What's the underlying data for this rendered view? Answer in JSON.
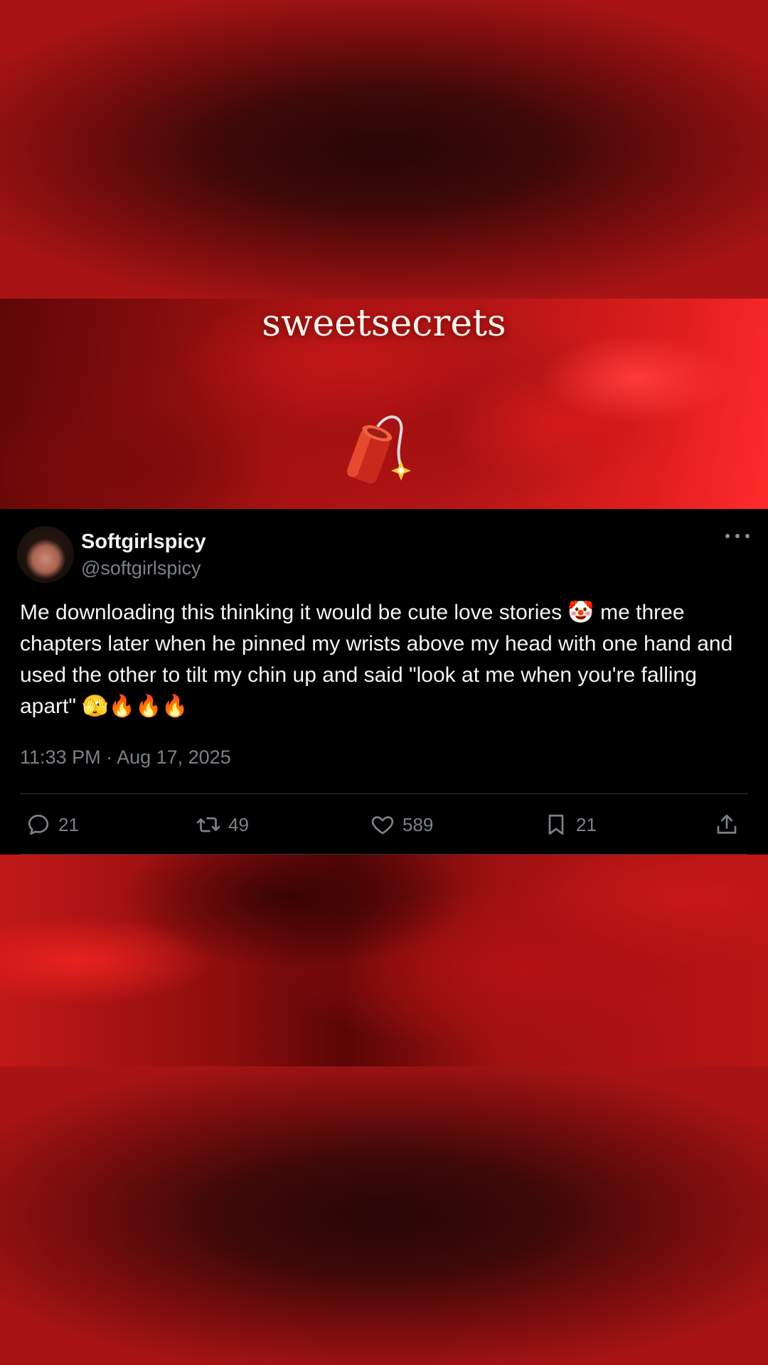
{
  "brand": {
    "title": "sweetsecrets"
  },
  "tweet": {
    "display_name": "Softgirlspicy",
    "handle": "@softgirlspicy",
    "text": "Me downloading this thinking it would be cute love stories 🤡 me three chapters later when he pinned my wrists above my head with one hand and used the other to tilt my chin up and said \"look at me when you're falling apart\" 🫣🔥🔥🔥",
    "timestamp": "11:33 PM · Aug 17, 2025",
    "actions": {
      "replies": "21",
      "reposts": "49",
      "likes": "589",
      "bookmarks": "21"
    }
  },
  "icons": {
    "reply": "comment-bubble-icon",
    "repost": "repost-arrows-icon",
    "like": "heart-icon",
    "bookmark": "bookmark-icon",
    "share": "share-upload-icon",
    "more": "more-dots-icon",
    "sticker": "firecracker-icon"
  },
  "colors": {
    "background": "#b3161a",
    "card": "#000000",
    "primary_text": "#f4f4f4",
    "secondary_text": "#7c8187",
    "divider": "#2f3336"
  }
}
